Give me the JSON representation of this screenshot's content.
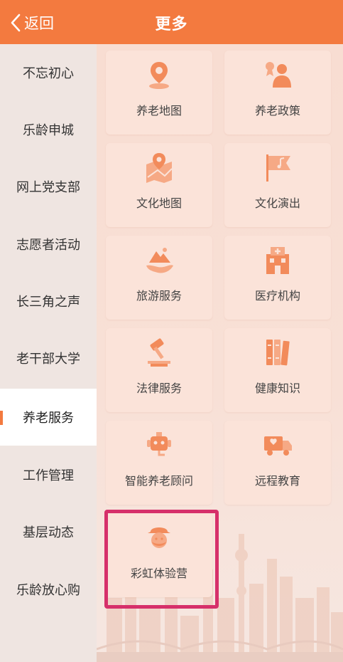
{
  "header": {
    "back_label": "返回",
    "title": "更多"
  },
  "sidebar": {
    "items": [
      {
        "label": "不忘初心"
      },
      {
        "label": "乐龄申城"
      },
      {
        "label": "网上党支部"
      },
      {
        "label": "志愿者活动"
      },
      {
        "label": "长三角之声"
      },
      {
        "label": "老干部大学"
      },
      {
        "label": "养老服务",
        "active": true
      },
      {
        "label": "工作管理"
      },
      {
        "label": "基层动态"
      },
      {
        "label": "乐龄放心购"
      }
    ]
  },
  "grid": {
    "tiles": [
      {
        "label": "养老地图",
        "icon": "map-pin-icon"
      },
      {
        "label": "养老政策",
        "icon": "award-person-icon"
      },
      {
        "label": "文化地图",
        "icon": "folded-map-icon"
      },
      {
        "label": "文化演出",
        "icon": "music-flag-icon"
      },
      {
        "label": "旅游服务",
        "icon": "mountain-hand-icon"
      },
      {
        "label": "医疗机构",
        "icon": "hospital-icon"
      },
      {
        "label": "法律服务",
        "icon": "gavel-icon"
      },
      {
        "label": "健康知识",
        "icon": "books-icon"
      },
      {
        "label": "智能养老顾问",
        "icon": "robot-icon"
      },
      {
        "label": "远程教育",
        "icon": "delivery-truck-icon"
      },
      {
        "label": "彩虹体验营",
        "icon": "person-hat-icon"
      }
    ]
  },
  "colors": {
    "accent": "#f37a3f",
    "highlight": "#d6306a",
    "icon": "#f28b5b"
  }
}
